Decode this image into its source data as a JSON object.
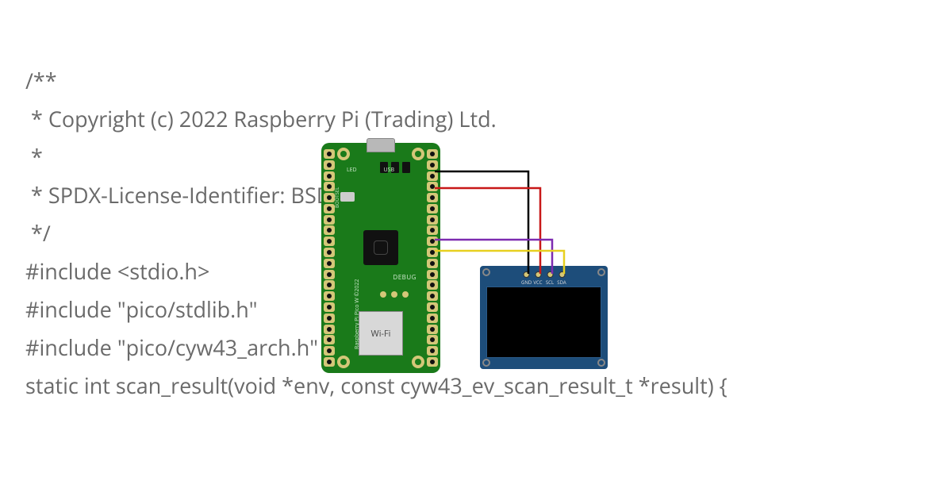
{
  "code": {
    "l1": "/**",
    "l2": " * Copyright (c) 2022 Raspberry Pi (Trading) Ltd.",
    "l3": " *",
    "l4": " * SPDX-License-Identifier: BSD-3-Clause",
    "l5": " */",
    "l6": "",
    "l7": "#include <stdio.h>",
    "l8": "",
    "l9": "#include \"pico/stdlib.h\"",
    "l10": "#include \"pico/cyw43_arch.h\"",
    "l11": "",
    "l12": "static int scan_result(void *env, const cyw43_ev_scan_result_t *result) {"
  },
  "board": {
    "name": "Raspberry Pi Pico W ©2022",
    "wifi_label": "Wi-Fi",
    "debug_label": "DEBUG",
    "usb_label": "USB",
    "led_label": "LED",
    "bootsel_label": "BOOTSEL"
  },
  "oled": {
    "pins": [
      "GND",
      "VCC",
      "SCL",
      "SDA"
    ]
  },
  "wires": {
    "gnd": "#000000",
    "vcc": "#c81818",
    "scl": "#7d2bb0",
    "sda": "#e8d020"
  }
}
